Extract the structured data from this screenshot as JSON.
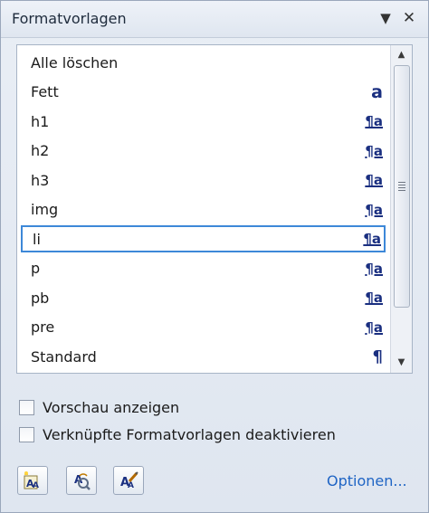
{
  "panel": {
    "title": "Formatvorlagen",
    "menu_glyph": "▼",
    "close_glyph": "✕"
  },
  "styles": [
    {
      "label": "Alle löschen",
      "icon": "",
      "icon_name": "none"
    },
    {
      "label": "Fett",
      "icon": "a",
      "icon_name": "character-style-icon"
    },
    {
      "label": "h1",
      "icon": "¶a",
      "icon_name": "linked-style-icon"
    },
    {
      "label": "h2",
      "icon": "¶a",
      "icon_name": "linked-style-icon"
    },
    {
      "label": "h3",
      "icon": "¶a",
      "icon_name": "linked-style-icon"
    },
    {
      "label": "img",
      "icon": "¶a",
      "icon_name": "linked-style-icon"
    },
    {
      "label": "li",
      "icon": "¶a",
      "icon_name": "linked-style-icon",
      "selected": true
    },
    {
      "label": "p",
      "icon": "¶a",
      "icon_name": "linked-style-icon"
    },
    {
      "label": "pb",
      "icon": "¶a",
      "icon_name": "linked-style-icon"
    },
    {
      "label": "pre",
      "icon": "¶a",
      "icon_name": "linked-style-icon"
    },
    {
      "label": "Standard",
      "icon": "¶",
      "icon_name": "paragraph-style-icon"
    }
  ],
  "scrollbar": {
    "up_glyph": "▲",
    "down_glyph": "▼"
  },
  "options": {
    "preview_label": "Vorschau anzeigen",
    "preview_checked": false,
    "disable_linked_label": "Verknüpfte Formatvorlagen deaktivieren",
    "disable_linked_checked": false
  },
  "footer": {
    "new_style_icon": "new-style-icon",
    "style_inspector_icon": "style-inspector-icon",
    "manage_styles_icon": "manage-styles-icon",
    "options_link": "Optionen..."
  },
  "colors": {
    "accent": "#3d88d8",
    "link": "#1f64c4",
    "style_icon": "#1a2f80"
  }
}
